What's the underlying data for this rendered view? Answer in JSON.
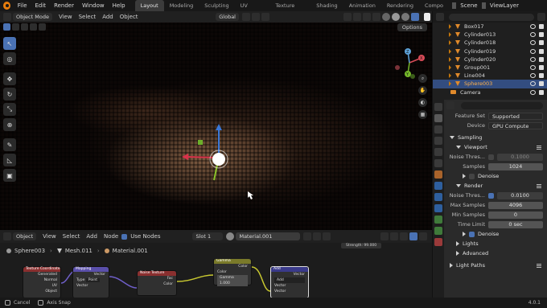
{
  "topbar": {
    "menus": [
      "File",
      "Edit",
      "Render",
      "Window",
      "Help"
    ],
    "workspaces": [
      "Layout",
      "Modeling",
      "Sculpting",
      "UV Editing",
      "Texture Paint",
      "Shading",
      "Animation",
      "Rendering",
      "Compo"
    ],
    "active_workspace": "Layout",
    "scene": "Scene",
    "view_layer": "ViewLayer"
  },
  "viewport_header": {
    "mode": "Object Mode",
    "menus": [
      "View",
      "Select",
      "Add",
      "Object"
    ],
    "transform": "Global",
    "options": "Options"
  },
  "navigation_gizmo": {
    "axes": [
      "X",
      "Y",
      "Z"
    ]
  },
  "node_editor": {
    "header": {
      "type": "Object",
      "menus": [
        "View",
        "Select",
        "Add",
        "Node"
      ],
      "use_nodes_label": "Use Nodes",
      "slot": "Slot 1",
      "material": "Material.001"
    },
    "breadcrumb": [
      "Sphere003",
      "Mesh.011",
      "Material.001"
    ],
    "strength_tag": "Strength: 99.000",
    "nodes": [
      {
        "title": "Texture Coordinate",
        "color": "#8a2f2f",
        "rows": [
          "Generated",
          "Normal",
          "UV",
          "Object"
        ]
      },
      {
        "title": "Mapping",
        "color": "#5a4faa",
        "rows": [
          "Vector",
          "Type",
          "Point",
          "Vector"
        ]
      },
      {
        "title": "Noise Texture",
        "color": "#8a2f2f",
        "rows": [
          "Fac",
          "Color"
        ]
      },
      {
        "title": "Gamma",
        "color": "#7a7a2a",
        "rows": [
          "Color",
          "Color",
          "Gamma",
          "1.000"
        ]
      },
      {
        "title": "Add",
        "color": "#3a3a8a",
        "rows": [
          "Vector",
          "Add",
          "Vector",
          "Vector"
        ]
      }
    ]
  },
  "status_bar": {
    "items": [
      "Cancel",
      "Axis Snap"
    ],
    "version": "4.0.1"
  },
  "outliner": {
    "items": [
      {
        "name": "Box017",
        "selected": false,
        "kind": "mesh"
      },
      {
        "name": "Cylinder013",
        "selected": false,
        "kind": "mesh"
      },
      {
        "name": "Cylinder018",
        "selected": false,
        "kind": "mesh"
      },
      {
        "name": "Cylinder019",
        "selected": false,
        "kind": "mesh"
      },
      {
        "name": "Cylinder020",
        "selected": false,
        "kind": "mesh"
      },
      {
        "name": "Group001",
        "selected": false,
        "kind": "mesh"
      },
      {
        "name": "Line004",
        "selected": false,
        "kind": "mesh"
      },
      {
        "name": "Sphere003",
        "selected": true,
        "kind": "mesh"
      },
      {
        "name": "Camera",
        "selected": false,
        "kind": "camera"
      }
    ]
  },
  "properties": {
    "feature_set_label": "Feature Set",
    "feature_set_value": "Supported",
    "device_label": "Device",
    "device_value": "GPU Compute",
    "sampling_label": "Sampling",
    "viewport_label": "Viewport",
    "viewport_noise_label": "Noise Thres...",
    "viewport_noise_value": "0.1000",
    "viewport_samples_label": "Samples",
    "viewport_samples_value": "1024",
    "viewport_denoise_label": "Denoise",
    "render_label": "Render",
    "render_noise_label": "Noise Thres...",
    "render_noise_value": "0.0100",
    "max_samples_label": "Max Samples",
    "max_samples_value": "4096",
    "min_samples_label": "Min Samples",
    "min_samples_value": "0",
    "time_limit_label": "Time Limit",
    "time_limit_value": "0 sec",
    "render_denoise_label": "Denoise",
    "lights_label": "Lights",
    "advanced_label": "Advanced",
    "light_paths_label": "Light Paths"
  },
  "colors": {
    "accent": "#4a72b4",
    "selection": "#334d80",
    "orange": "#e87d0d"
  }
}
